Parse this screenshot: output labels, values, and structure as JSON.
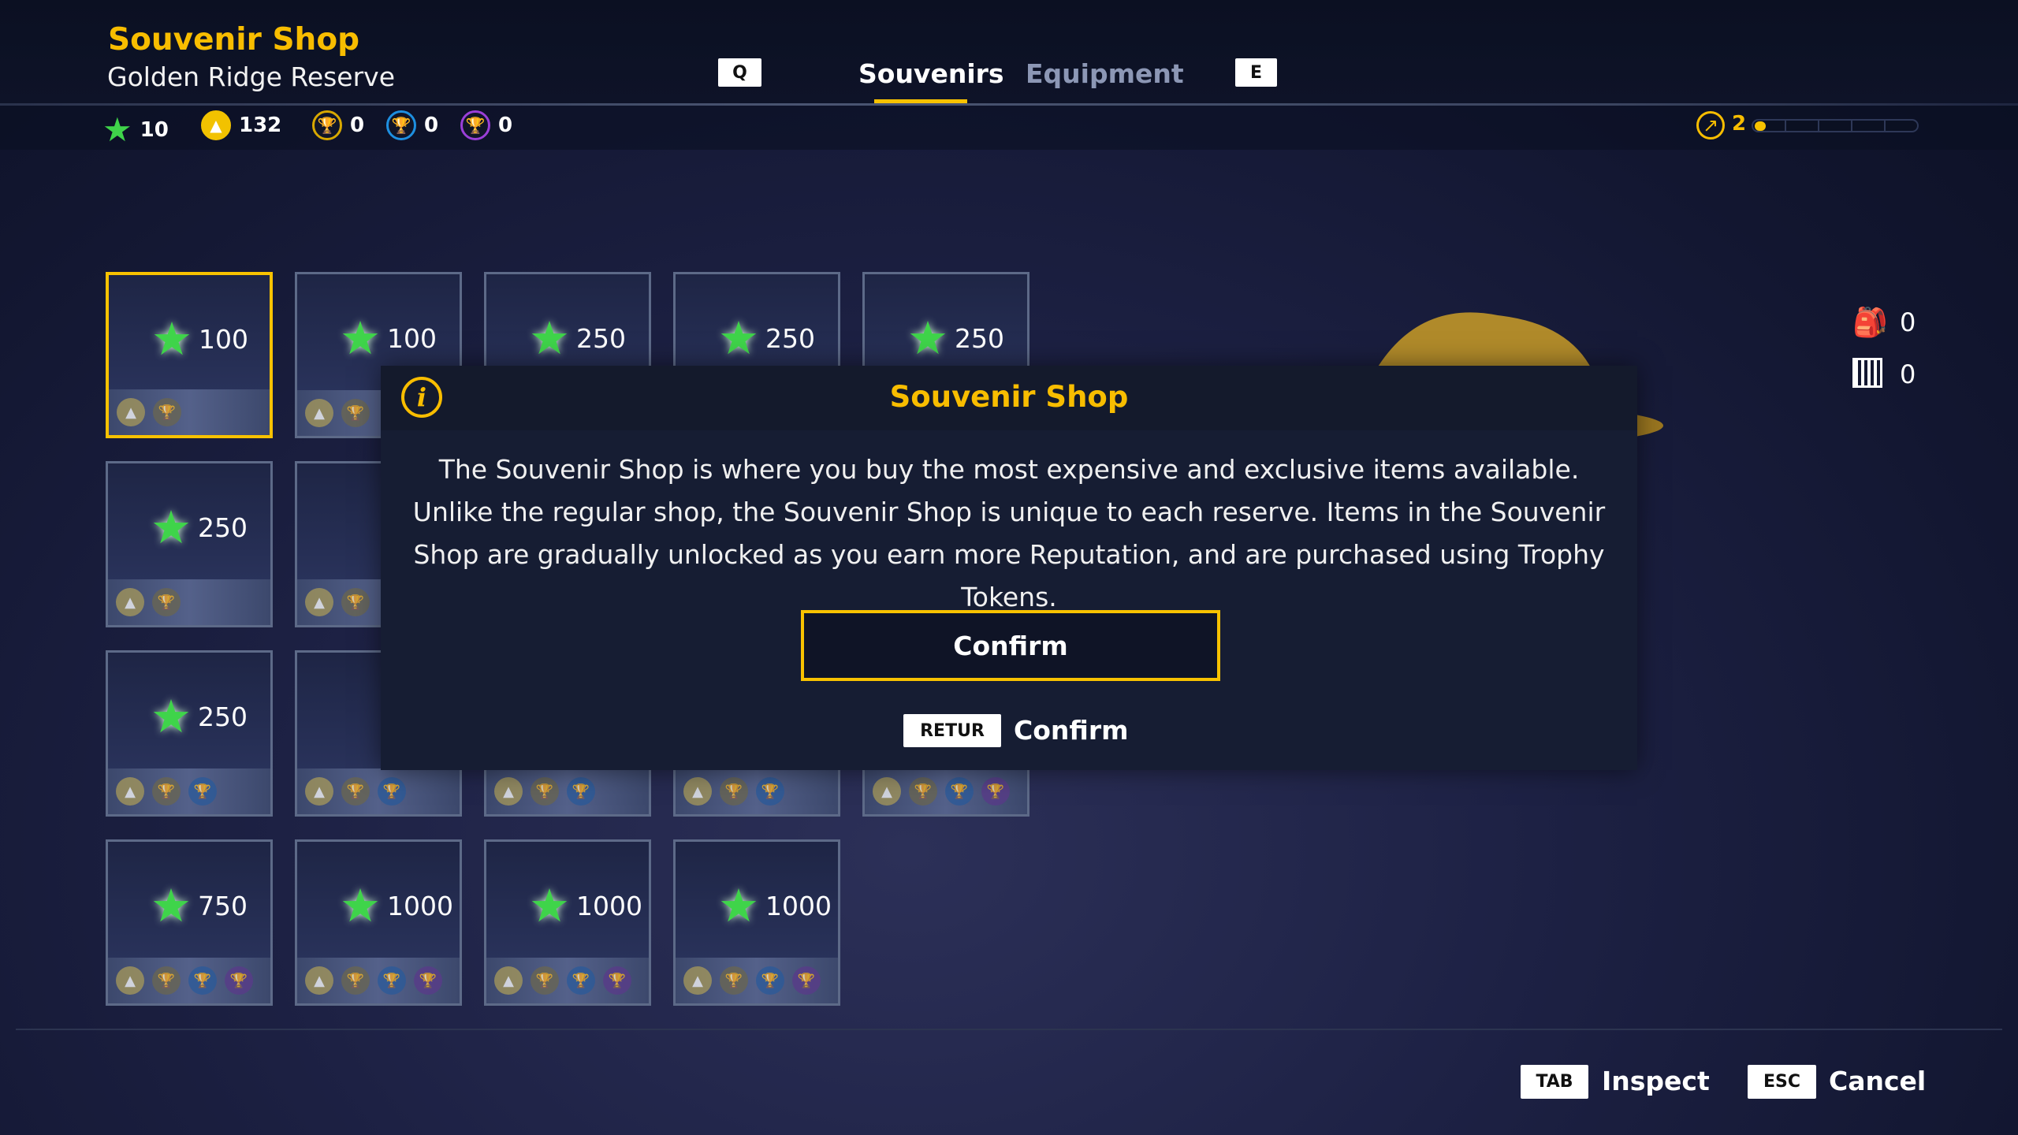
{
  "header": {
    "title": "Souvenir Shop",
    "subtitle": "Golden Ridge Reserve"
  },
  "tabs": {
    "prev_key": "Q",
    "next_key": "E",
    "items": [
      {
        "label": "Souvenirs",
        "active": true
      },
      {
        "label": "Equipment",
        "active": false
      }
    ]
  },
  "currencies": [
    {
      "icon": "green-star-icon",
      "value": "10",
      "color": "#3fd44a"
    },
    {
      "icon": "gold-coin-icon",
      "value": "132",
      "color": "#f2c200"
    },
    {
      "icon": "gold-trophy-icon",
      "value": "0",
      "color": "#d8a800"
    },
    {
      "icon": "blue-trophy-icon",
      "value": "0",
      "color": "#1e8fe0"
    },
    {
      "icon": "purple-trophy-icon",
      "value": "0",
      "color": "#9b3fd8"
    }
  ],
  "reputation": {
    "level": "2",
    "progress_segments": 5,
    "progress_fraction": 0.05
  },
  "inventory": {
    "backpack_count": "0",
    "crate_count": "0"
  },
  "cards": [
    {
      "price": "100",
      "currencies": [
        "coin",
        "gold"
      ],
      "selected": true
    },
    {
      "price": "100",
      "currencies": [
        "coin",
        "gold"
      ]
    },
    {
      "price": "250",
      "currencies": [
        "coin",
        "gold"
      ]
    },
    {
      "price": "250",
      "currencies": [
        "coin",
        "gold"
      ]
    },
    {
      "price": "250",
      "currencies": [
        "coin",
        "gold"
      ]
    },
    {
      "price": "250",
      "currencies": [
        "coin",
        "gold"
      ]
    },
    {
      "price": "",
      "currencies": [
        "coin",
        "gold"
      ]
    },
    {
      "price": "",
      "currencies": [
        "coin",
        "gold"
      ]
    },
    {
      "price": "",
      "currencies": [
        "coin",
        "gold"
      ]
    },
    {
      "price": "",
      "currencies": [
        "coin",
        "gold"
      ]
    },
    {
      "price": "250",
      "currencies": [
        "coin",
        "gold",
        "blue"
      ]
    },
    {
      "price": "",
      "currencies": [
        "coin",
        "gold",
        "blue"
      ]
    },
    {
      "price": "",
      "currencies": [
        "coin",
        "gold",
        "blue"
      ]
    },
    {
      "price": "",
      "currencies": [
        "coin",
        "gold",
        "blue"
      ]
    },
    {
      "price": "",
      "currencies": [
        "coin",
        "gold",
        "blue",
        "purple"
      ]
    },
    {
      "price": "750",
      "currencies": [
        "coin",
        "gold",
        "blue",
        "purple"
      ]
    },
    {
      "price": "1000",
      "currencies": [
        "coin",
        "gold",
        "blue",
        "purple"
      ]
    },
    {
      "price": "1000",
      "currencies": [
        "coin",
        "gold",
        "blue",
        "purple"
      ]
    },
    {
      "price": "1000",
      "currencies": [
        "coin",
        "gold",
        "blue",
        "purple"
      ]
    }
  ],
  "modal": {
    "title": "Souvenir Shop",
    "body": "The Souvenir Shop is where you buy the most expensive and exclusive items available. Unlike the regular shop, the Souvenir Shop is unique to each reserve. Items in the Souvenir Shop are gradually unlocked as you earn more Reputation, and are purchased using Trophy Tokens.",
    "confirm_label": "Confirm",
    "hint_key": "RETUR",
    "hint_label": "Confirm"
  },
  "footer": {
    "inspect_key": "TAB",
    "inspect_label": "Inspect",
    "cancel_key": "ESC",
    "cancel_label": "Cancel"
  }
}
